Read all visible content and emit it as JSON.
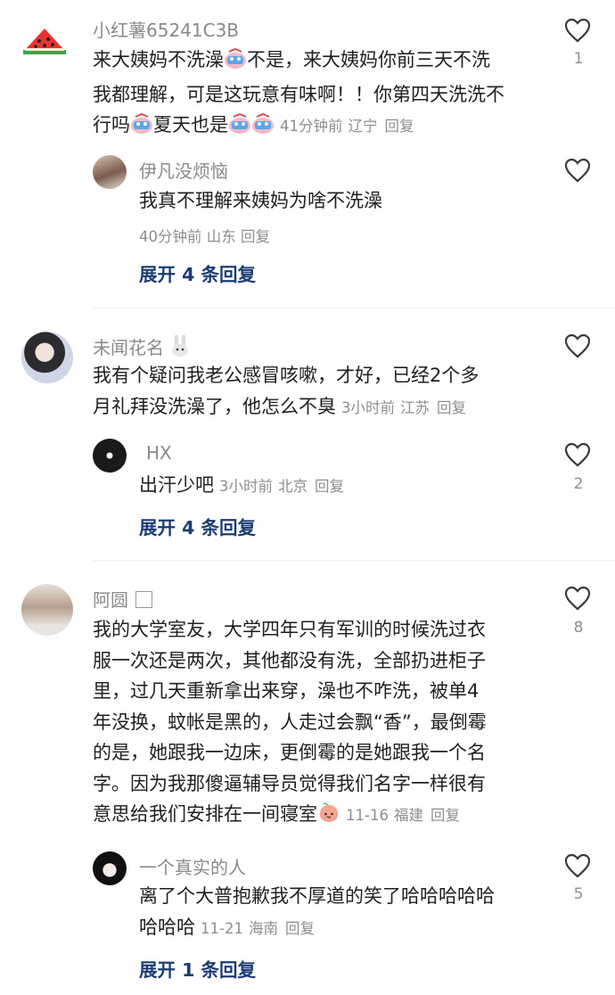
{
  "colors": {
    "name": "#8a8a8a",
    "text": "#1f1f1f",
    "meta": "#8e8e8e",
    "expand": "#1c3d74"
  },
  "comments": [
    {
      "user": "小红薯65241C3B",
      "avatar_icon": "watermelon-icon",
      "lines": [
        "来大姨妈不洗澡",
        "不是，来大姨妈你前三天不洗",
        "我都理解，可是这玩意有味啊！！你第四天洗洗不",
        "行吗",
        "夏天也是"
      ],
      "time": "41分钟前",
      "location": "辽宁",
      "reply_label": "回复",
      "likes": "1",
      "replies": [
        {
          "user": "伊凡没烦恼",
          "text": "我真不理解来姨妈为啥不洗澡",
          "time": "40分钟前",
          "location": "山东",
          "reply_label": "回复"
        }
      ],
      "expand_label": "展开 4 条回复"
    },
    {
      "user": "未闻花名",
      "user_badge_icon": "bunny-icon",
      "lines": [
        "我有个疑问我老公感冒咳嗽，才好，已经2个多",
        "月礼拜没洗澡了，他怎么不臭"
      ],
      "time": "3小时前",
      "location": "江苏",
      "reply_label": "回复",
      "replies": [
        {
          "user": "HX",
          "text": "出汗少吧",
          "time": "3小时前",
          "location": "北京",
          "reply_label": "回复",
          "likes": "2"
        }
      ],
      "expand_label": "展开 4 条回复"
    },
    {
      "user": "阿圆",
      "lines": [
        "我的大学室友，大学四年只有军训的时候洗过衣",
        "服一次还是两次，其他都没有洗，全部扔进柜子",
        "里，过几天重新拿出来穿，澡也不咋洗，被单4",
        "年没换，蚊帐是黑的，人走过会飘“香”，最倒霉",
        "的是，她跟我一边床，更倒霉的是她跟我一个名",
        "字。因为我那傻逼辅导员觉得我们名字一样很有",
        "意思给我们安排在一间寝室"
      ],
      "time": "11-16",
      "location": "福建",
      "reply_label": "回复",
      "likes": "8",
      "replies": [
        {
          "user": "一个真实的人",
          "lines": [
            "离了个大普抱歉我不厚道的笑了哈哈哈哈哈",
            "哈哈哈"
          ],
          "time": "11-21",
          "location": "海南",
          "reply_label": "回复",
          "likes": "5"
        }
      ],
      "expand_label": "展开 1 条回复"
    }
  ]
}
